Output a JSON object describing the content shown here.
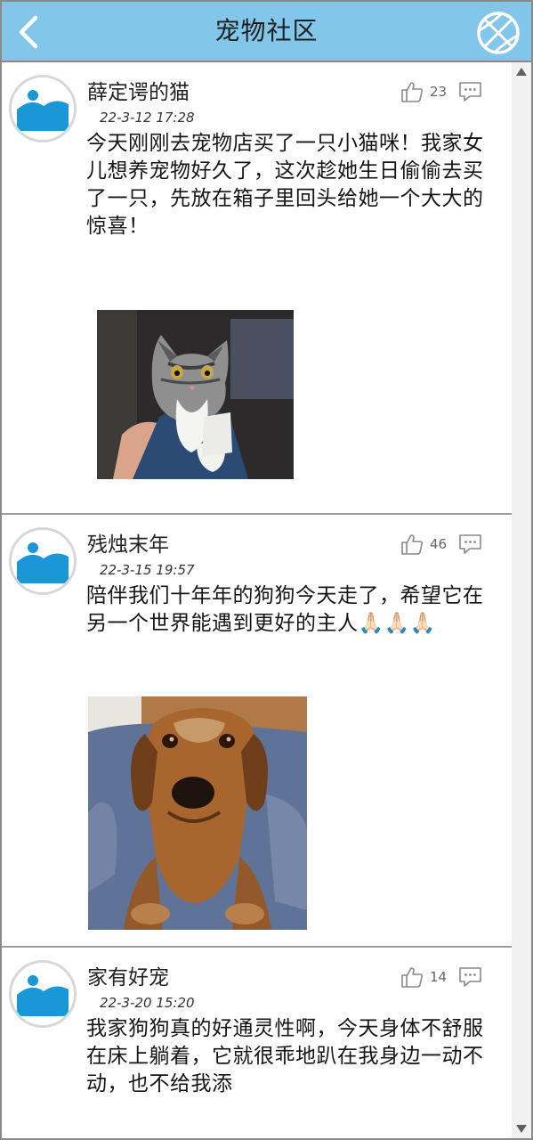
{
  "header": {
    "title": "宠物社区",
    "back_icon": "chevron-left-icon",
    "action_icon": "basketball-icon",
    "bar_color": "#82c6ea"
  },
  "posts": [
    {
      "username": "薛定谔的猫",
      "timestamp": "22-3-12 17:28",
      "likes": "23",
      "content": "今天刚刚去宠物店买了一只小猫咪！我家女儿想养宠物好久了，这次趁她生日偷偷去买了一只，先放在箱子里回头给她一个大大的惊喜！",
      "image": "cat-photo"
    },
    {
      "username": "残烛末年",
      "timestamp": "22-3-15 19:57",
      "likes": "46",
      "content": "陪伴我们十年年的狗狗今天走了，希望它在另一个世界能遇到更好的主人🙏🏻🙏🏻🙏🏻",
      "image": "dog-photo"
    },
    {
      "username": "家有好宠",
      "timestamp": "22-3-20 15:20",
      "likes": "14",
      "content": "我家狗狗真的好通灵性啊，今天身体不舒服在床上躺着，它就很乖地趴在我身边一动不动，也不给我添",
      "image": ""
    }
  ]
}
